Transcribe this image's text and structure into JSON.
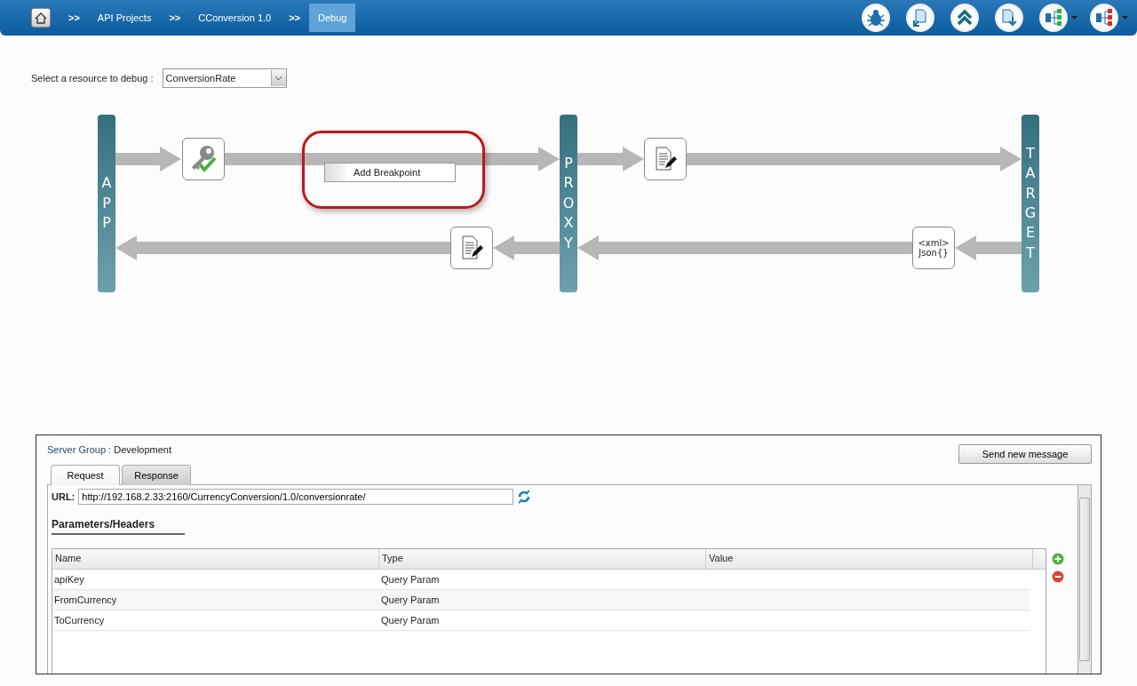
{
  "breadcrumbs": [
    {
      "label": "API Projects",
      "selected": false
    },
    {
      "label": "CConversion 1.0",
      "selected": false
    },
    {
      "label": "Debug",
      "selected": true
    }
  ],
  "breadcrumb_separator": ">>",
  "resource_select": {
    "label": "Select a resource to debug :",
    "value": "ConversionRate"
  },
  "lanes": [
    {
      "label": "APP"
    },
    {
      "label": "PROXY"
    },
    {
      "label": "TARGET"
    }
  ],
  "flow_nodes": [
    {
      "kind": "key"
    },
    {
      "kind": "edit"
    },
    {
      "kind": "edit"
    },
    {
      "kind": "format",
      "top_text": "<xml>",
      "bottom_text": "Json{}"
    }
  ],
  "context_menu": {
    "item": "Add Breakpoint"
  },
  "server_group": {
    "label": "Server Group :",
    "value": "Development"
  },
  "send_button": "Send new message",
  "tabs": [
    {
      "label": "Request",
      "selected": true
    },
    {
      "label": "Response",
      "selected": false
    }
  ],
  "url": {
    "label": "URL:",
    "value": "http://192.168.2.33:2160/CurrencyConversion/1.0/conversionrate/"
  },
  "section_title": "Parameters/Headers",
  "table": {
    "columns": [
      "Name",
      "Type",
      "Value"
    ],
    "rows": [
      [
        "apiKey",
        "Query Param",
        ""
      ],
      [
        "FromCurrency",
        "Query Param",
        ""
      ],
      [
        "ToCurrency",
        "Query Param",
        ""
      ]
    ]
  }
}
